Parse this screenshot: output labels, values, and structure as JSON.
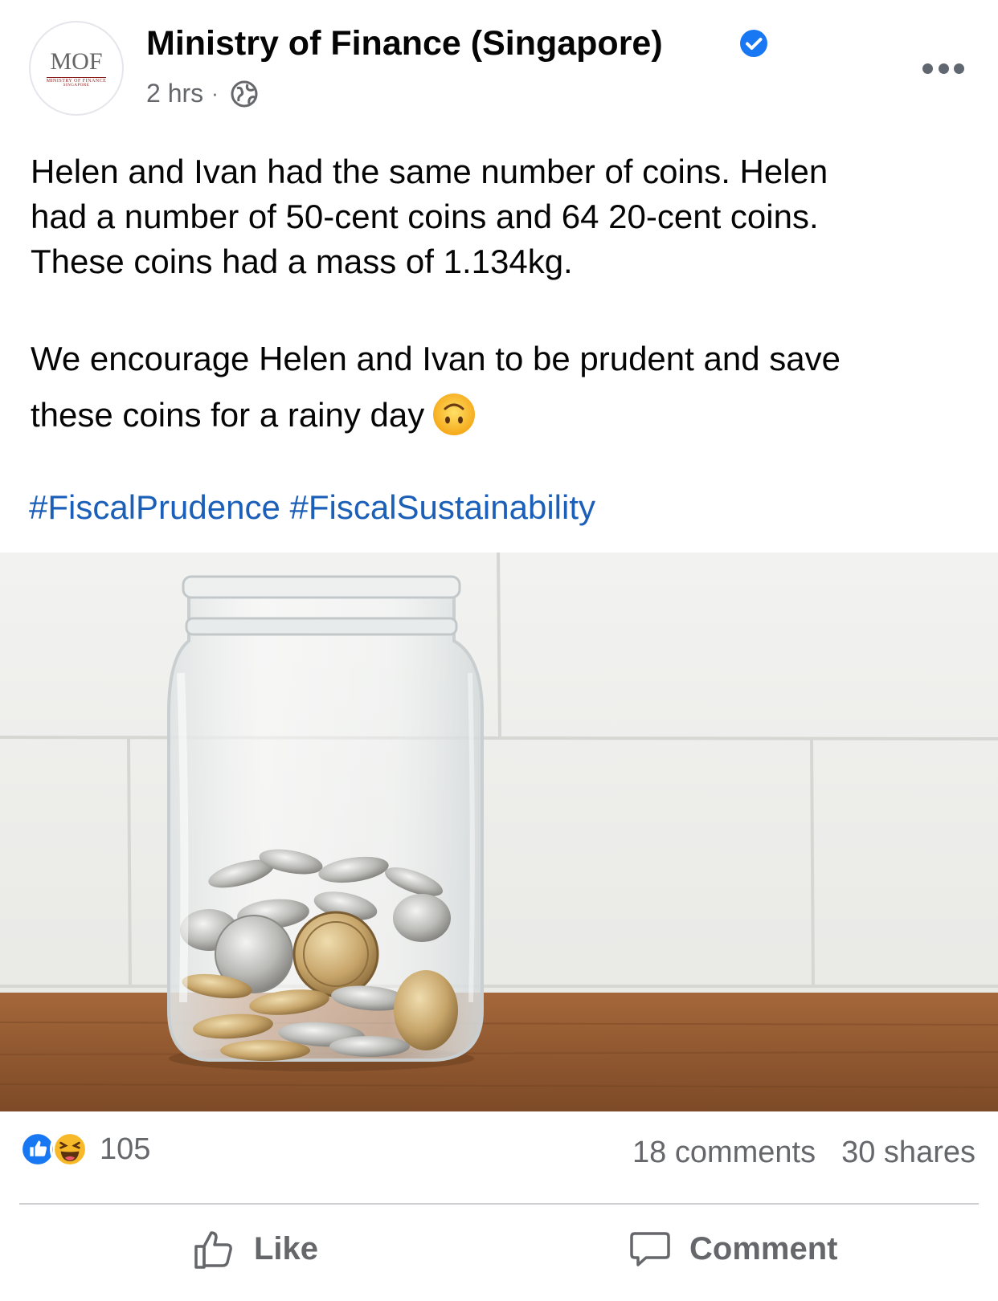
{
  "post": {
    "page_name": "Ministry of Finance (Singapore)",
    "avatar": {
      "logo_text": "MOF",
      "logo_subtext": "MINISTRY OF FINANCE",
      "logo_subtext2": "SINGAPORE"
    },
    "time": "2 hrs",
    "separator": "·",
    "text_lines": [
      "Helen and Ivan had the same number of coins. Helen",
      "had a number of 50-cent coins and 64 20-cent coins.",
      "These coins had a mass of 1.134kg."
    ],
    "text_para2_line1": "We encourage Helen and Ivan to be prudent and save",
    "text_para2_line2": "these coins for a rainy day",
    "hashtags": [
      "#FiscalPrudence",
      "#FiscalSustainability"
    ]
  },
  "stats": {
    "reaction_count": "105",
    "comments": "18 comments",
    "shares": "30 shares"
  },
  "actions": {
    "like_label": "Like",
    "comment_label": "Comment"
  },
  "colors": {
    "hashtag": "#1b5fb8",
    "verified": "#1877f2",
    "secondary_text": "#65676b",
    "like_blue": "#1877f2",
    "haha_yellow": "#f7b928"
  },
  "icons": [
    "verified-badge-icon",
    "globe-icon",
    "more-options-icon",
    "upside-down-face-emoji-icon",
    "like-reaction-icon",
    "haha-reaction-icon",
    "thumbs-up-icon",
    "comment-bubble-icon"
  ]
}
